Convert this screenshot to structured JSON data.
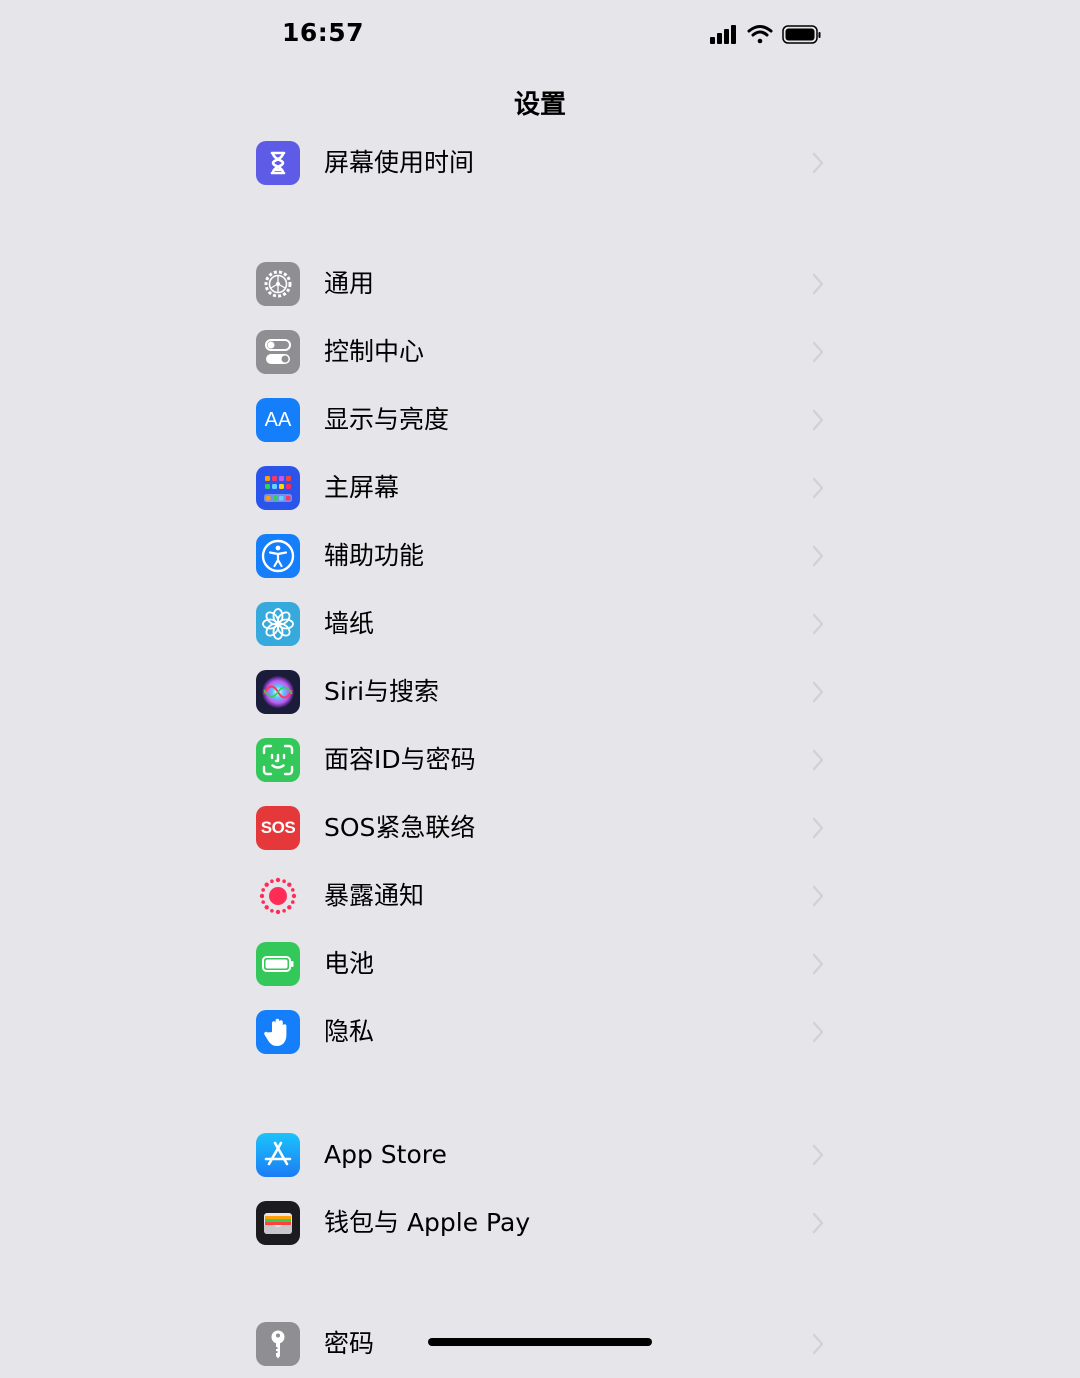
{
  "status_bar": {
    "time": "16:57",
    "battery_level": 1.0,
    "signal_bars": 4
  },
  "nav": {
    "title": "设置"
  },
  "groups": [
    {
      "items": [
        {
          "label": "屏幕使用时间",
          "icon": "hourglass-icon",
          "color": "#5e5ce6"
        }
      ]
    },
    {
      "items": [
        {
          "label": "通用",
          "icon": "gear-icon",
          "color": "#8e8e93"
        },
        {
          "label": "控制中心",
          "icon": "toggles-icon",
          "color": "#8e8e93"
        },
        {
          "label": "显示与亮度",
          "icon": "text-size-icon",
          "icon_text": "AA",
          "color": "#147efb"
        },
        {
          "label": "主屏幕",
          "icon": "home-grid-icon",
          "color": "#2b55ea"
        },
        {
          "label": "辅助功能",
          "icon": "accessibility-icon",
          "color": "#147efb"
        },
        {
          "label": "墙纸",
          "icon": "flower-icon",
          "color": "#36aadc"
        },
        {
          "label": "Siri与搜索",
          "icon": "siri-icon",
          "color": "#1b1b3a"
        },
        {
          "label": "面容ID与密码",
          "icon": "face-id-icon",
          "color": "#34c759"
        },
        {
          "label": "SOS紧急联络",
          "icon": "sos-icon",
          "icon_text": "SOS",
          "color": "#e5383b"
        },
        {
          "label": "暴露通知",
          "icon": "exposure-icon",
          "color": "#ff2d55"
        },
        {
          "label": "电池",
          "icon": "battery-icon",
          "color": "#34c759"
        },
        {
          "label": "隐私",
          "icon": "hand-icon",
          "color": "#147efb"
        }
      ]
    },
    {
      "items": [
        {
          "label": "App Store",
          "icon": "app-store-icon",
          "color": "#1c8ef9"
        },
        {
          "label": "钱包与 Apple Pay",
          "icon": "wallet-icon",
          "color": "#1c1c1e"
        }
      ]
    },
    {
      "items": [
        {
          "label": "密码",
          "icon": "key-icon",
          "color": "#8e8e93"
        }
      ]
    }
  ]
}
